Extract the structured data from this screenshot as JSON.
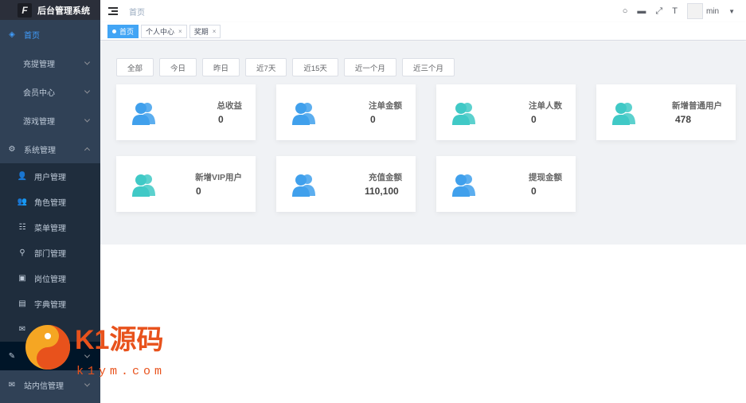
{
  "app": {
    "title": "后台管理系统",
    "logo_letter": "F"
  },
  "sidebar": {
    "items": [
      {
        "label": "首页",
        "icon": "dashboard-icon",
        "glyph": "◈",
        "level": "top",
        "active": true
      },
      {
        "label": "充提管理",
        "level": "lvl1",
        "chevron": "down"
      },
      {
        "label": "会员中心",
        "level": "lvl1",
        "chevron": "down"
      },
      {
        "label": "游戏管理",
        "level": "lvl1",
        "chevron": "down"
      },
      {
        "label": "系统管理",
        "icon": "gear-icon",
        "glyph": "⚙",
        "level": "top",
        "chevron": "up"
      },
      {
        "label": "用户管理",
        "icon": "user-icon",
        "glyph": "👤",
        "level": "sub"
      },
      {
        "label": "角色管理",
        "icon": "role-icon",
        "glyph": "👥",
        "level": "sub"
      },
      {
        "label": "菜单管理",
        "icon": "tree-table-icon",
        "glyph": "☷",
        "level": "sub"
      },
      {
        "label": "部门管理",
        "icon": "tree-icon",
        "glyph": "⚲",
        "level": "sub"
      },
      {
        "label": "岗位管理",
        "icon": "post-icon",
        "glyph": "▣",
        "level": "sub"
      },
      {
        "label": "字典管理",
        "icon": "dict-icon",
        "glyph": "▤",
        "level": "sub"
      },
      {
        "label": "",
        "icon": "message-icon",
        "glyph": "✉",
        "level": "sub"
      },
      {
        "label": "",
        "icon": "log-icon",
        "glyph": "✎",
        "level": "top",
        "chevron": "down",
        "selected": true
      },
      {
        "label": "站内信管理",
        "icon": "chat-icon",
        "glyph": "✉",
        "level": "top",
        "chevron": "down"
      }
    ]
  },
  "navbar": {
    "breadcrumb": "首页",
    "username": "min"
  },
  "tags": [
    {
      "label": "首页",
      "active": true
    },
    {
      "label": "个人中心",
      "closable": true
    },
    {
      "label": "奖期",
      "closable": true
    }
  ],
  "filters": [
    "全部",
    "今日",
    "昨日",
    "近7天",
    "近15天",
    "近一个月",
    "近三个月"
  ],
  "cards": [
    {
      "label": "总收益",
      "value": "0",
      "color": "#40a0ec"
    },
    {
      "label": "注单金额",
      "value": "0",
      "color": "#40a0ec"
    },
    {
      "label": "注单人数",
      "value": "0",
      "color": "#40c9c6"
    },
    {
      "label": "新增普通用户",
      "value": "478",
      "color": "#40c9c6"
    },
    {
      "label": "新增VIP用户",
      "value": "0",
      "color": "#40c9c6"
    },
    {
      "label": "充值金额",
      "value": "110,100",
      "color": "#40a0ec"
    },
    {
      "label": "提现金额",
      "value": "0",
      "color": "#40a0ec"
    }
  ],
  "watermark": {
    "brand": "K1源码",
    "url": "k1ym.com"
  },
  "colors": {
    "sidebar_bg": "#304156",
    "accent": "#409eff",
    "main_bg": "#f0f2f5"
  }
}
